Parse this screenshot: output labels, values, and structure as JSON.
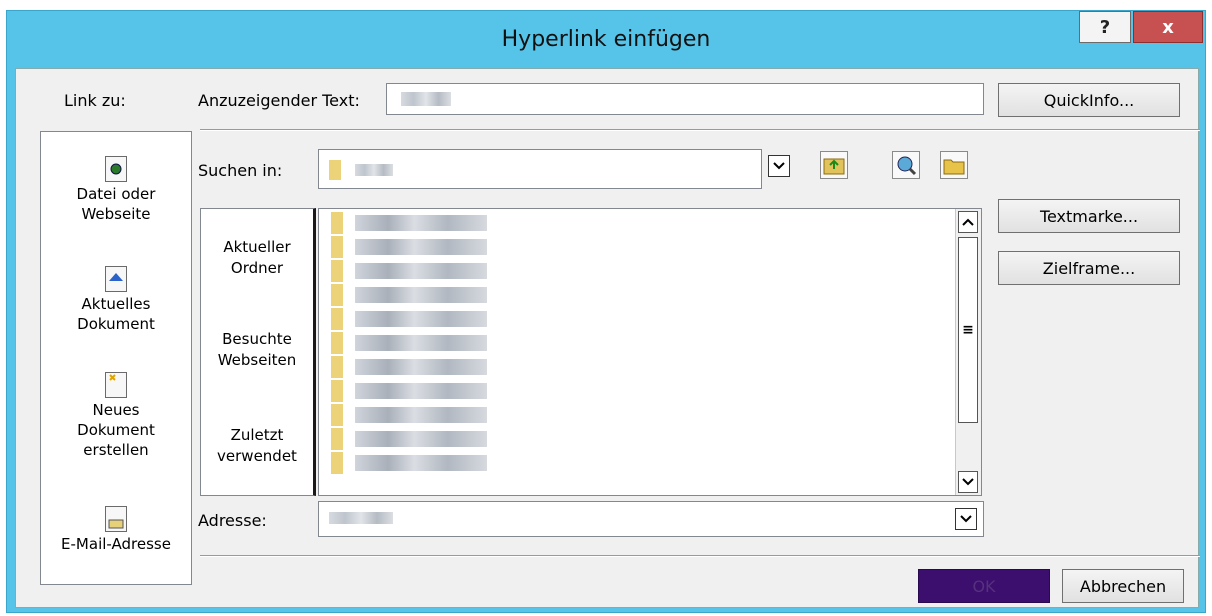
{
  "window": {
    "title": "Hyperlink einfügen",
    "help_label": "?",
    "close_label": "x"
  },
  "link_to": {
    "heading": "Link zu:",
    "items": [
      {
        "label_line1": "Datei oder",
        "label_line2": "Webseite",
        "icon": "file-web-icon"
      },
      {
        "label_line1": "Aktuelles",
        "label_line2": "Dokument",
        "icon": "current-document-icon"
      },
      {
        "label_line1": "Neues",
        "label_line2": "Dokument",
        "label_line3": "erstellen",
        "icon": "new-document-icon"
      },
      {
        "label_line1": "E-Mail-Adresse",
        "icon": "email-icon"
      }
    ]
  },
  "display_text": {
    "label": "Anzuzeigender Text:"
  },
  "quickinfo_button": "QuickInfo...",
  "search_in": {
    "label": "Suchen in:"
  },
  "places": [
    {
      "line1": "Aktueller",
      "line2": "Ordner"
    },
    {
      "line1": "Besuchte",
      "line2": "Webseiten"
    },
    {
      "line1": "Zuletzt",
      "line2": "verwendet"
    }
  ],
  "bookmark_button": "Textmarke...",
  "targetframe_button": "Zielframe...",
  "address": {
    "label": "Adresse:"
  },
  "ok_button": "OK",
  "cancel_button": "Abbrechen",
  "colors": {
    "titlebar": "#55c4e8",
    "close_button": "#c75050",
    "ok_button": "#3c0e6e"
  }
}
